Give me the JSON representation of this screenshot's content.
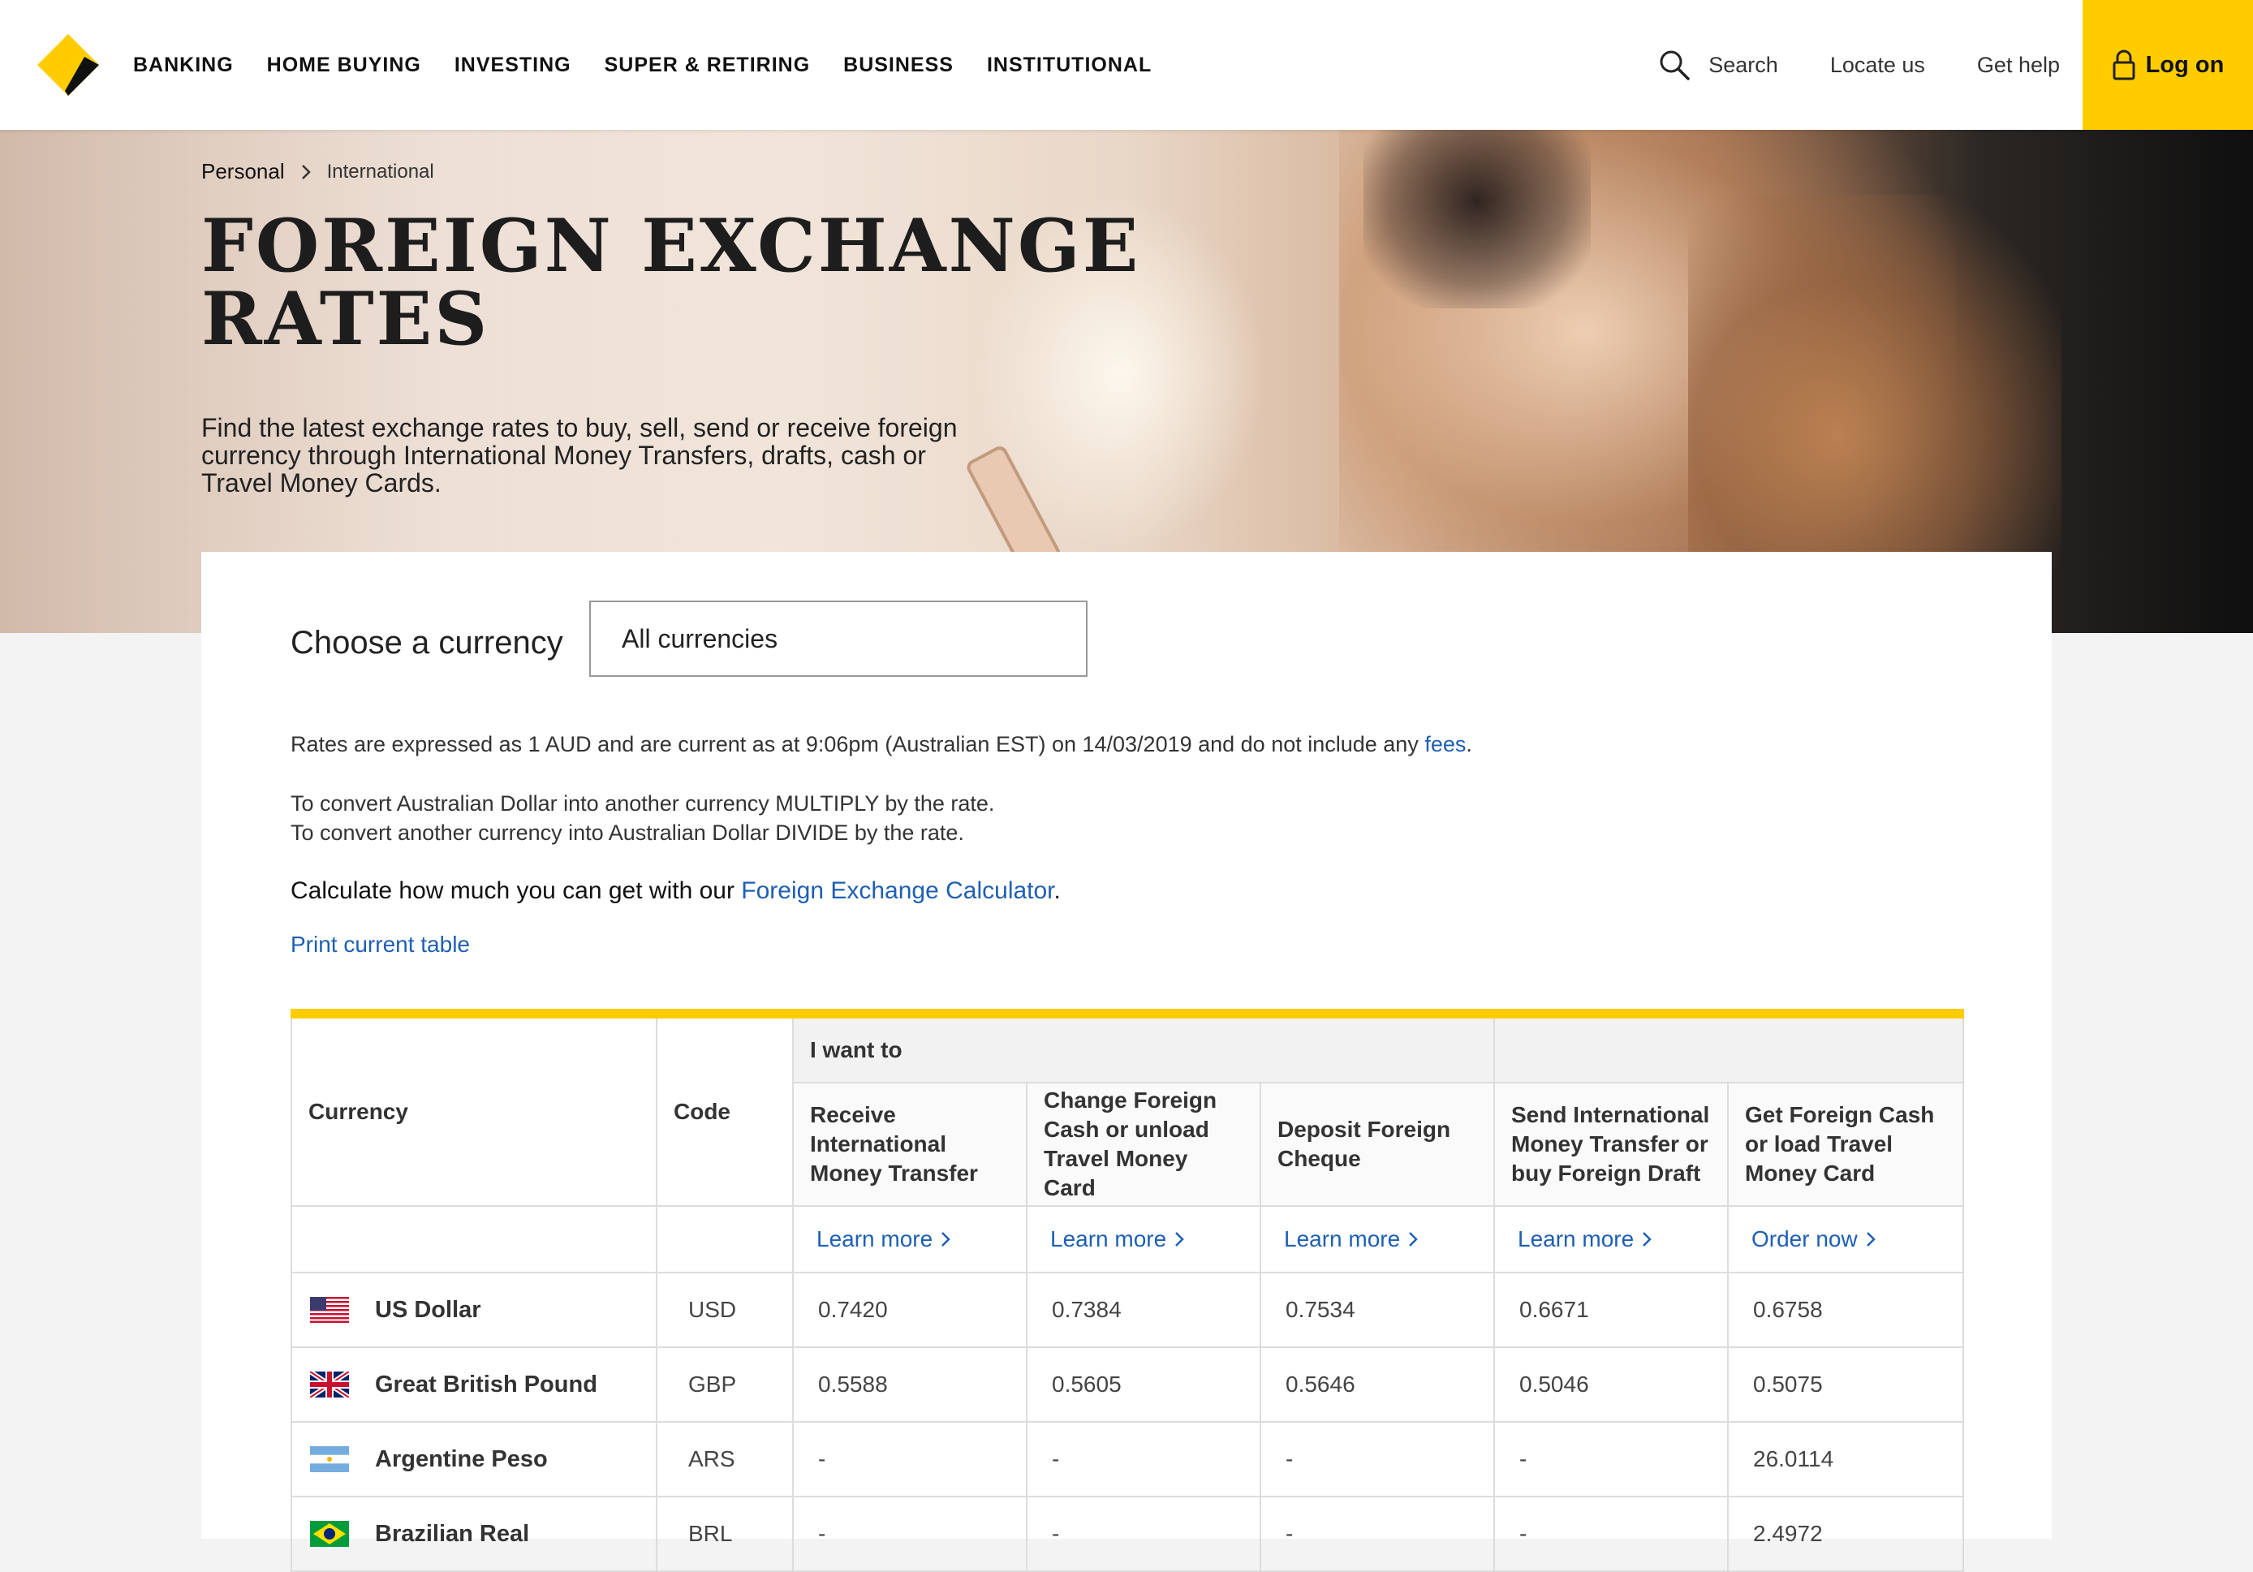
{
  "header": {
    "nav": [
      "BANKING",
      "HOME BUYING",
      "INVESTING",
      "SUPER & RETIRING",
      "BUSINESS",
      "INSTITUTIONAL"
    ],
    "search_label": "Search",
    "locate_label": "Locate us",
    "help_label": "Get help",
    "logon_label": "Log on"
  },
  "hero": {
    "breadcrumb": [
      "Personal",
      "International"
    ],
    "title_line1": "FOREIGN EXCHANGE",
    "title_line2": "RATES",
    "intro": "Find the latest exchange rates to buy, sell, send or receive foreign currency through International Money Transfers, drafts, cash or Travel Money Cards."
  },
  "main": {
    "choose_label": "Choose a currency",
    "select_value": "All currencies",
    "rates_note_pre": "Rates are expressed as 1 AUD and are current as at 9:06pm (Australian EST) on 14/03/2019 and do not include any ",
    "rates_note_link": "fees",
    "rates_note_post": ".",
    "convert_multiply": "To convert Australian Dollar into another currency MULTIPLY by the rate.",
    "convert_divide": "To convert another currency into Australian Dollar DIVIDE by the rate.",
    "calc_pre": "Calculate how much you can get with our ",
    "calc_link": "Foreign Exchange Calculator",
    "calc_post": ".",
    "print_link": "Print current table"
  },
  "table": {
    "col_currency": "Currency",
    "col_code": "Code",
    "group_label": "I want to",
    "group2_label": "",
    "columns": [
      "Receive International Money Transfer",
      "Change Foreign Cash or unload Travel Money Card",
      "Deposit Foreign Cheque",
      "Send International Money Transfer or buy Foreign Draft",
      "Get Foreign Cash or load Travel Money Card"
    ],
    "links": [
      "Learn more",
      "Learn more",
      "Learn more",
      "Learn more",
      "Order now"
    ],
    "rows": [
      {
        "name": "US Dollar",
        "code": "USD",
        "flag": "us-flag",
        "rates": [
          "0.7420",
          "0.7384",
          "0.7534",
          "0.6671",
          "0.6758"
        ]
      },
      {
        "name": "Great British Pound",
        "code": "GBP",
        "flag": "uk-flag",
        "rates": [
          "0.5588",
          "0.5605",
          "0.5646",
          "0.5046",
          "0.5075"
        ]
      },
      {
        "name": "Argentine Peso",
        "code": "ARS",
        "flag": "argentina-flag",
        "rates": [
          "-",
          "-",
          "-",
          "-",
          "26.0114"
        ]
      },
      {
        "name": "Brazilian Real",
        "code": "BRL",
        "flag": "brazil-flag",
        "rates": [
          "-",
          "-",
          "-",
          "-",
          "2.4972"
        ]
      }
    ]
  },
  "colors": {
    "brand_yellow": "#ffcc00",
    "link_blue": "#1e5fb4"
  }
}
